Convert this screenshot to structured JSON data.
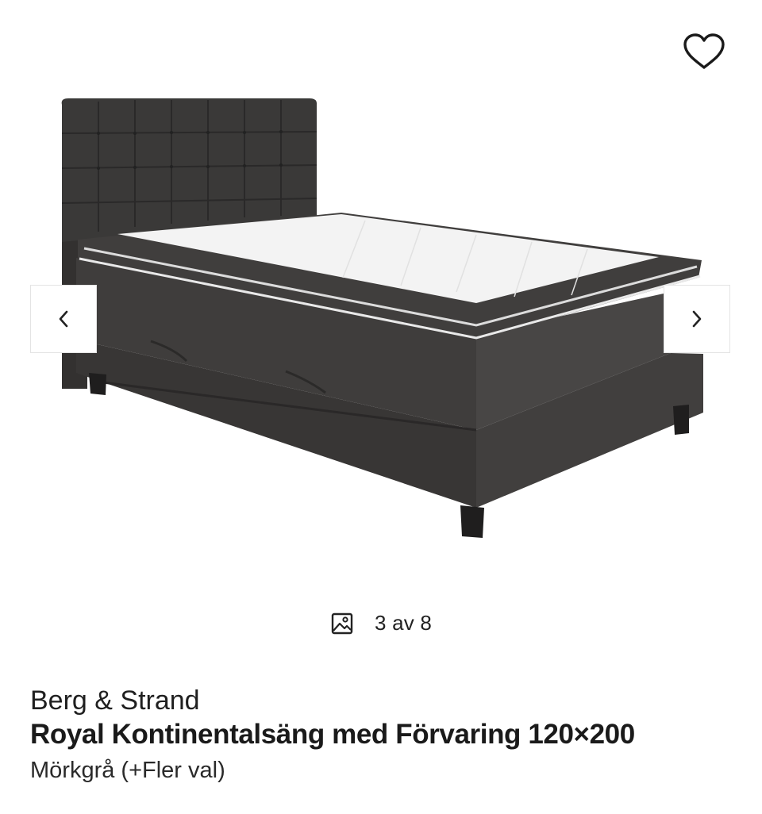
{
  "gallery": {
    "counter_text": "3 av 8",
    "image_alt": "Dark grey continental bed with tufted headboard, white mattress topper and storage drawers",
    "icons": {
      "favorite": "heart-outline-icon",
      "prev": "chevron-left-icon",
      "next": "chevron-right-icon",
      "counter": "image-icon"
    }
  },
  "product": {
    "brand": "Berg & Strand",
    "title": "Royal Kontinentalsäng med Förvaring 120×200",
    "variant": "Mörkgrå (+Fler val)"
  },
  "colors": {
    "fabric": "#3d3b3a",
    "topper": "#f4f4f4",
    "text": "#1d1d1d"
  }
}
